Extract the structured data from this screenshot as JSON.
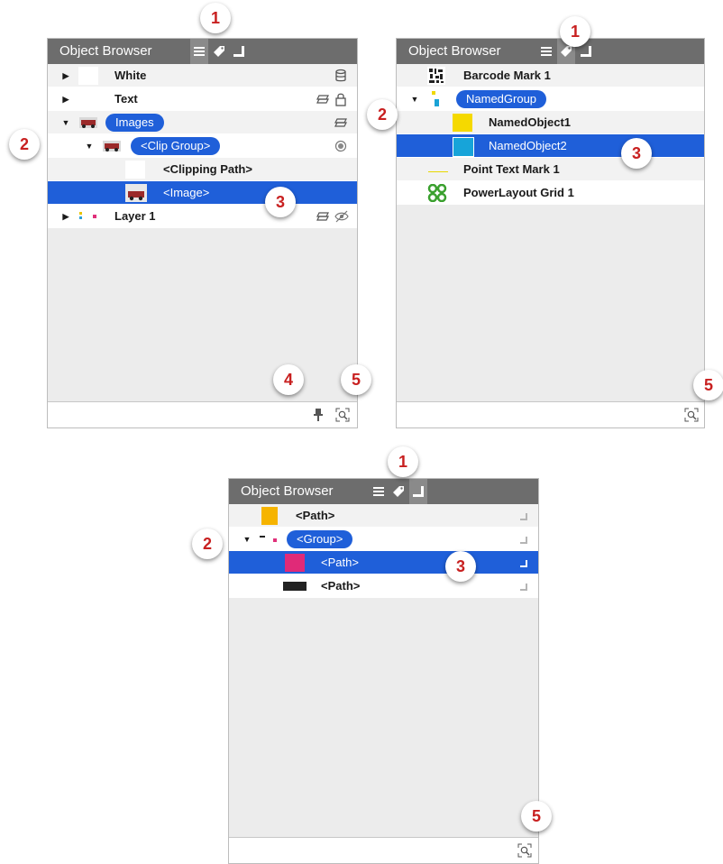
{
  "panels": {
    "a": {
      "title": "Object Browser",
      "rows": [
        "White",
        "Text",
        "Images",
        "<Clip Group>",
        "<Clipping Path>",
        "<Image>",
        "Layer 1"
      ]
    },
    "b": {
      "title": "Object Browser",
      "rows": [
        "Barcode Mark 1",
        "NamedGroup",
        "NamedObject1",
        "NamedObject2",
        "Point Text Mark 1",
        "PowerLayout Grid 1"
      ]
    },
    "c": {
      "title": "Object Browser",
      "rows": [
        "<Path>",
        "<Group>",
        "<Path>",
        "<Path>"
      ]
    }
  },
  "callouts": {
    "one": "1",
    "two": "2",
    "three": "3",
    "four": "4",
    "five": "5"
  },
  "icons": {
    "mode_buttons": [
      "list-icon",
      "tag-icon",
      "corner-icon"
    ],
    "footer": [
      "pin-icon",
      "zoom-to-object-icon"
    ],
    "row_status": [
      "database-icon",
      "layer-stack-icon",
      "lock-icon",
      "radio-dot-icon",
      "hidden-eye-icon"
    ]
  },
  "colors": {
    "titlebar": "#6d6d6d",
    "selection": "#1f5fd9",
    "callout_number": "#c82020",
    "panel_background": "#ececec"
  }
}
